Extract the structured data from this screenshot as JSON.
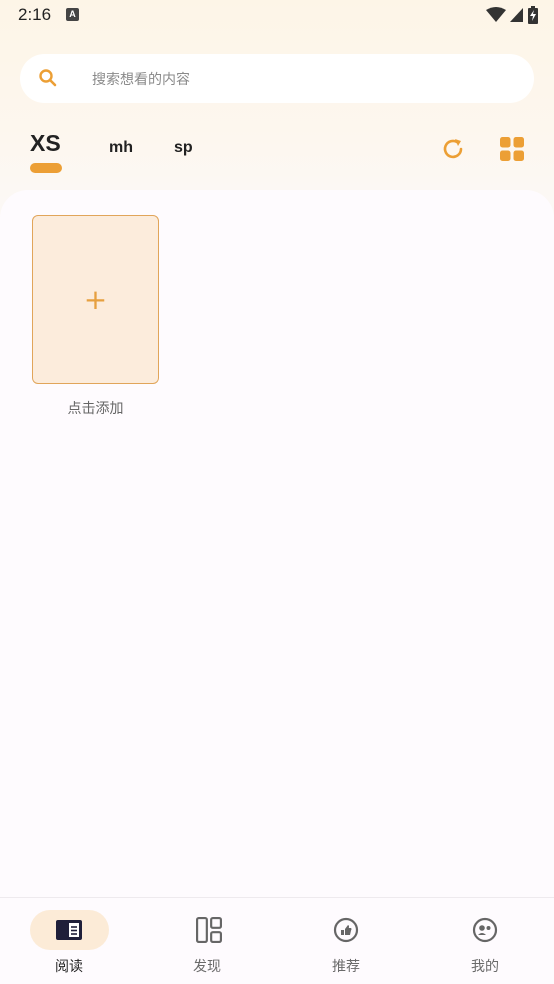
{
  "status_bar": {
    "time": "2:16",
    "notification_icon": "A"
  },
  "search": {
    "placeholder": "搜索想看的内容"
  },
  "tabs": [
    {
      "label": "XS",
      "active": true
    },
    {
      "label": "mh",
      "active": false
    },
    {
      "label": "sp",
      "active": false
    }
  ],
  "toolbar": {
    "refresh_icon": "refresh-icon",
    "layout_icon": "grid-icon"
  },
  "shelf": {
    "add_symbol": "+",
    "add_label": "点击添加"
  },
  "bottom_nav": [
    {
      "label": "阅读",
      "icon": "book-icon",
      "active": true
    },
    {
      "label": "发现",
      "icon": "layout-icon",
      "active": false
    },
    {
      "label": "推荐",
      "icon": "thumbs-up-icon",
      "active": false
    },
    {
      "label": "我的",
      "icon": "profile-icon",
      "active": false
    }
  ],
  "colors": {
    "accent": "#ec9f35",
    "card_bg": "#fcecdc",
    "nav_pill": "#fcebd7"
  }
}
